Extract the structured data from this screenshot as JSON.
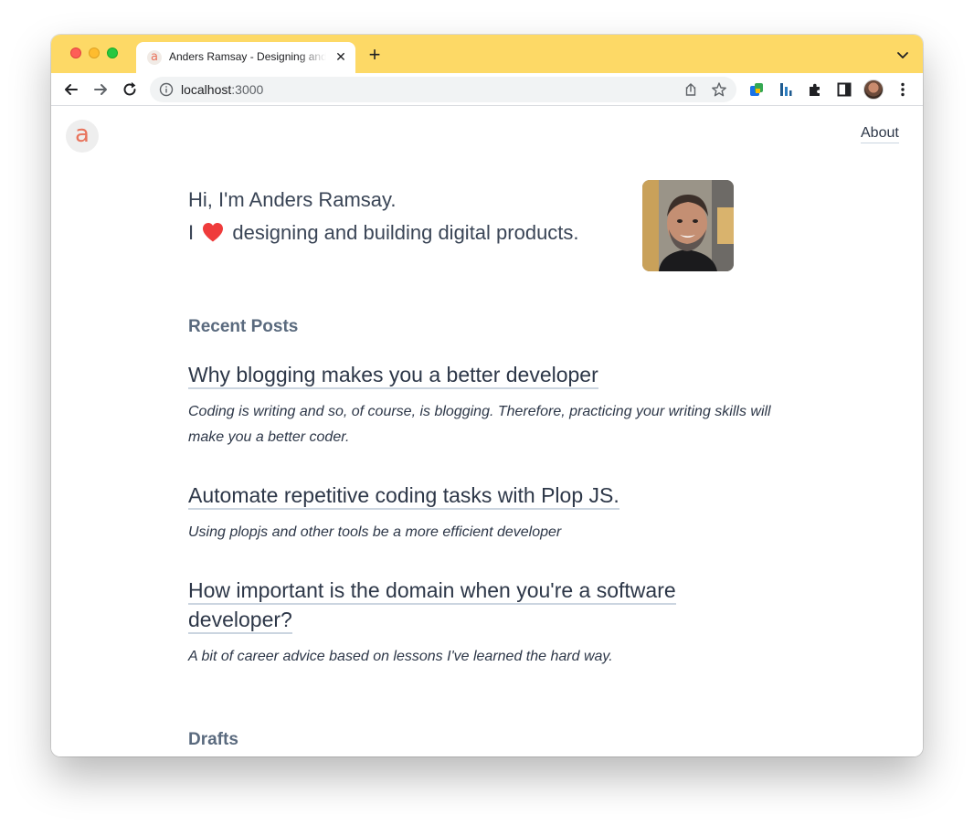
{
  "browser": {
    "tab_title": "Anders Ramsay - Designing and Building",
    "tab_favicon_letter": "a",
    "address_host": "localhost",
    "address_port": ":3000",
    "chrome_color": "#fdd966"
  },
  "site": {
    "logo_letter": "a",
    "nav": {
      "about_label": "About"
    },
    "intro": {
      "line1": "Hi, I'm Anders Ramsay.",
      "line2_prefix": "I",
      "line2_suffix": "designing and building digital products."
    },
    "accent_color": "#e8735c",
    "heart_color": "#ef3b3b"
  },
  "recent_posts": {
    "heading": "Recent Posts",
    "items": [
      {
        "title": "Why blogging makes you a better developer",
        "description": "Coding is writing and so, of course, is blogging. Therefore, practicing your writing skills will make you a better coder."
      },
      {
        "title": "Automate repetitive coding tasks with Plop JS.",
        "description": "Using plopjs and other tools be a more efficient developer"
      },
      {
        "title_line1": "How important is the domain when you're a software",
        "title_line2": "developer?",
        "description": "A bit of career advice based on lessons I've learned the hard way."
      }
    ]
  },
  "drafts": {
    "heading": "Drafts"
  }
}
